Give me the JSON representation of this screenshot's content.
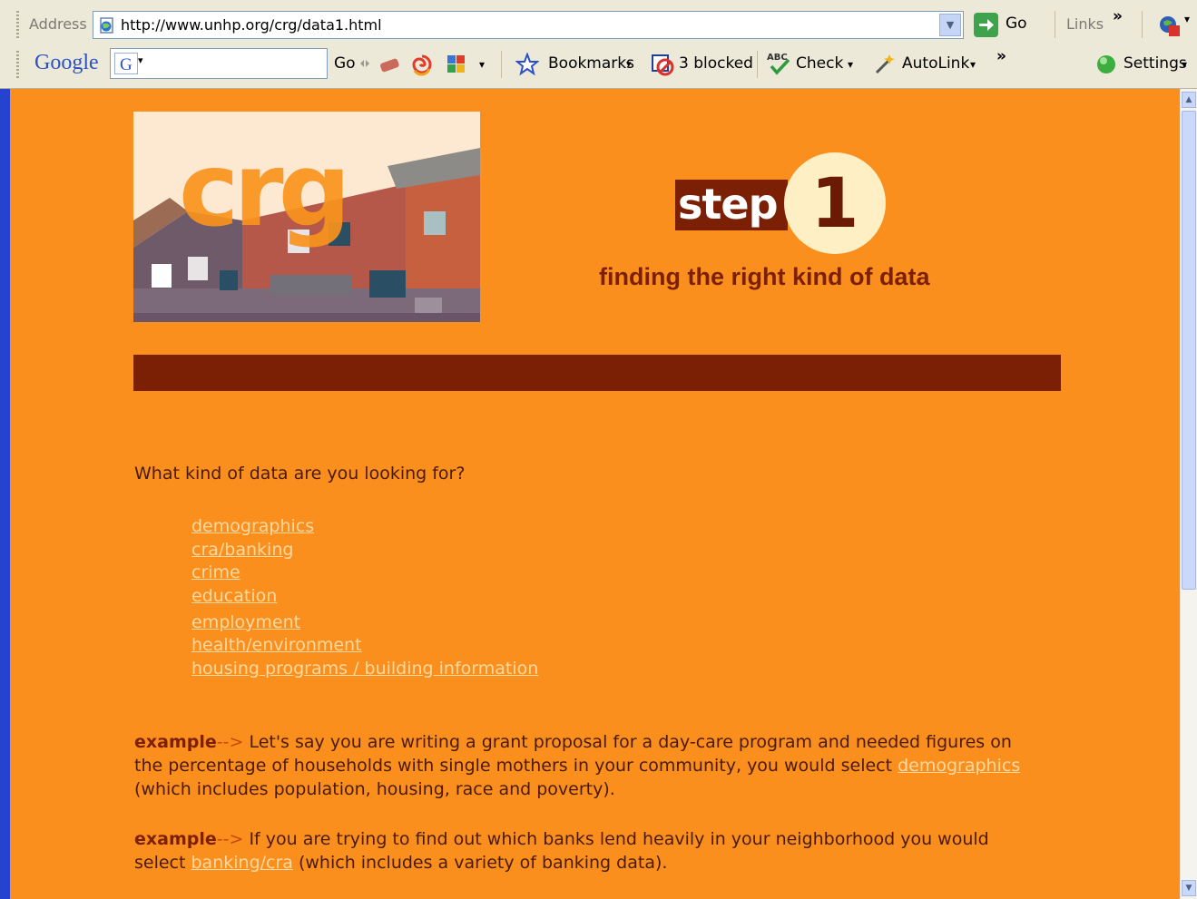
{
  "browser": {
    "address_label": "Address",
    "url": "http://www.unhp.org/crg/data1.html",
    "go_label": "Go",
    "links_label": "Links",
    "chevron": "»",
    "google_logo": "Google",
    "google_go_label": "Go",
    "bookmarks_label": "Bookmarks",
    "blocked_label": "3 blocked",
    "check_label": "Check",
    "autolink_label": "AutoLink",
    "settings_label": "Settings",
    "dropdown_caret": "▾"
  },
  "page": {
    "logo_text": "crg",
    "step_word": "step",
    "step_number": "1",
    "subtitle": "finding the right kind of data",
    "question": "What kind of data are you looking for?",
    "links": [
      "demographics",
      "cra/banking",
      "crime",
      "education",
      "employment",
      "health/environment",
      "housing programs / building information"
    ],
    "example1": {
      "label": "example",
      "arrow": "-->",
      "text_before": " Let's say you are writing a grant proposal for a day-care program and needed figures on the percentage of households with single mothers in your community, you would select ",
      "link": "demographics",
      "text_after": " (which includes population, housing, race and poverty)."
    },
    "example2": {
      "label": "example",
      "arrow": "-->",
      "text_before": " If you are trying to find out which banks lend heavily in your neighborhood you would select ",
      "link": "banking/cra",
      "text_after": " (which includes a variety of banking data)."
    }
  },
  "colors": {
    "page_bg": "#fb8f1d",
    "dark_brown": "#7c2005",
    "link": "#ffd9a2",
    "circle": "#ffefc4"
  }
}
